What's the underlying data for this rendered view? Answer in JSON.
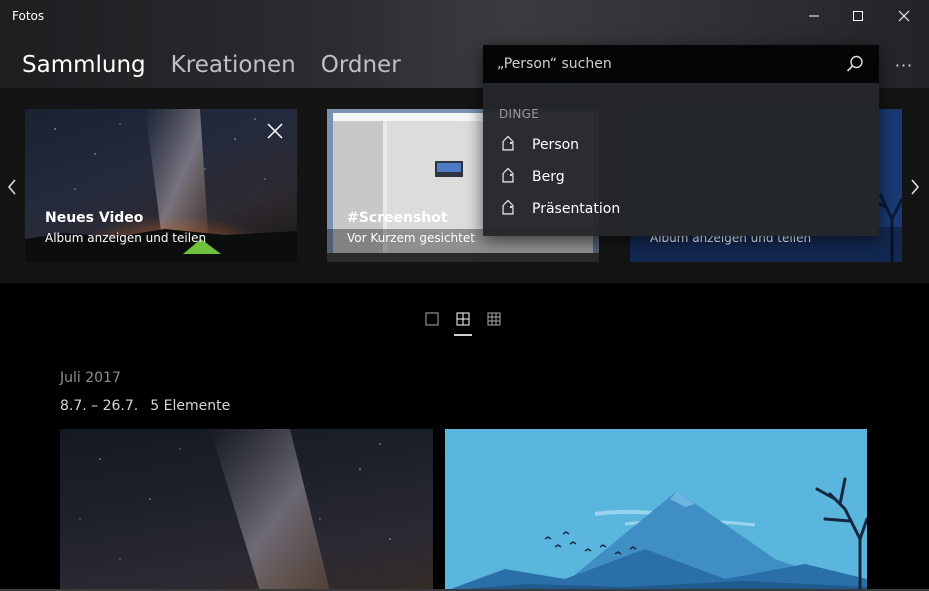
{
  "window": {
    "title": "Fotos",
    "controls": {
      "minimize": "—",
      "maximize": "☐",
      "close": "✕"
    }
  },
  "nav": {
    "tabs": [
      {
        "label": "Sammlung",
        "active": true
      },
      {
        "label": "Kreationen",
        "active": false
      },
      {
        "label": "Ordner",
        "active": false
      }
    ],
    "more": "···"
  },
  "albums": [
    {
      "title": "Neues Video",
      "subtitle": "Album anzeigen und teilen"
    },
    {
      "title": "#Screenshot",
      "subtitle": "Vor Kurzem gesichtet"
    },
    {
      "title": "",
      "subtitle": "Album anzeigen und teilen"
    }
  ],
  "search": {
    "placeholder": "„Person“ suchen",
    "section": "DINGE",
    "suggestions": [
      {
        "label": "Person",
        "icon": "tag-icon"
      },
      {
        "label": "Berg",
        "icon": "tag-icon"
      },
      {
        "label": "Präsentation",
        "icon": "tag-icon"
      }
    ]
  },
  "view_modes": [
    {
      "icon": "single-view-icon",
      "active": false
    },
    {
      "icon": "medium-grid-icon",
      "active": true
    },
    {
      "icon": "small-grid-icon",
      "active": false
    }
  ],
  "collection": {
    "month": "Juli 2017",
    "range": "8.7. – 26.7.",
    "count": "5 Elemente"
  },
  "colors": {
    "background": "#000000",
    "panel": "#242629",
    "accent_sky": "#5bb6de",
    "mountain": "#2e7bb4"
  }
}
